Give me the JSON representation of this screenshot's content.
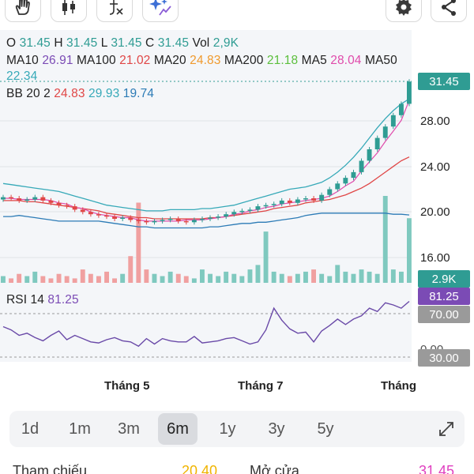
{
  "toolbar": {
    "hand_icon": "hand-icon",
    "candles_icon": "candlestick-icon",
    "indicator_icon": "function-icon",
    "sparkle_icon": "ai-sparkle-icon",
    "settings_icon": "gear-icon",
    "share_icon": "share-icon"
  },
  "ohlc": {
    "o_label": "O",
    "o": "31.45",
    "h_label": "H",
    "h": "31.45",
    "l_label": "L",
    "l": "31.45",
    "c_label": "C",
    "c": "31.45",
    "vol_label": "Vol",
    "vol": "2,9K"
  },
  "ma": {
    "ma10_label": "MA10",
    "ma10": "26.91",
    "ma100_label": "MA100",
    "ma100": "21.02",
    "ma20_label": "MA20",
    "ma20": "24.83",
    "ma200_label": "MA200",
    "ma200": "21.18",
    "ma5_label": "MA5",
    "ma5": "28.04",
    "ma50_label": "MA50",
    "ma50": "22.34"
  },
  "bb": {
    "label": "BB 20 2",
    "mid": "24.83",
    "upper": "29.93",
    "lower": "19.74"
  },
  "rsi": {
    "label": "RSI 14",
    "value": "81.25",
    "level_high": "70.00",
    "level_low": "30.00",
    "hidden_label": "0.00"
  },
  "price_axis": {
    "current": "31.45",
    "ticks": [
      "28.00",
      "24.00",
      "20.00",
      "16.00"
    ],
    "volume": "2.9K"
  },
  "months": [
    "Tháng 5",
    "Tháng 7",
    "Tháng"
  ],
  "ranges": {
    "r1d": "1d",
    "r1m": "1m",
    "r3m": "3m",
    "r6m": "6m",
    "r1y": "1y",
    "r3y": "3y",
    "r5y": "5y",
    "active": "6m"
  },
  "bottom": {
    "ref_label": "Tham chiếu",
    "ref_value": "20.40",
    "open_label": "Mở cửa",
    "open_value": "31.45"
  },
  "colors": {
    "up": "#2f9c93",
    "down": "#e04646",
    "current_tag": "#2f9c93",
    "rsi_tag": "#7b4bb5",
    "level_tag": "#9a9a9a",
    "rsi_line": "#6a4aa8"
  },
  "chart_data": {
    "type": "line",
    "price": {
      "current": 31.45,
      "ylim": [
        14,
        32
      ],
      "closes": [
        21.3,
        21.2,
        21.0,
        21.1,
        21.3,
        21.0,
        20.8,
        20.6,
        20.5,
        20.2,
        20.0,
        19.8,
        19.7,
        19.6,
        19.4,
        19.5,
        19.3,
        19.2,
        19.1,
        19.2,
        19.3,
        19.4,
        19.2,
        19.1,
        19.3,
        19.4,
        19.5,
        19.6,
        19.8,
        20.0,
        20.1,
        20.2,
        20.5,
        20.6,
        20.7,
        21.0,
        20.8,
        21.1,
        21.2,
        21.0,
        21.5,
        22.0,
        22.5,
        23.0,
        23.5,
        24.5,
        25.5,
        26.5,
        27.5,
        28.5,
        29.5,
        31.45
      ],
      "ma5": [
        21.2,
        21.2,
        21.1,
        21.1,
        21.1,
        21.1,
        21.0,
        20.8,
        20.7,
        20.4,
        20.3,
        20.0,
        19.8,
        19.7,
        19.6,
        19.5,
        19.5,
        19.3,
        19.2,
        19.2,
        19.2,
        19.2,
        19.2,
        19.3,
        19.3,
        19.3,
        19.4,
        19.5,
        19.6,
        19.8,
        19.9,
        20.1,
        20.2,
        20.4,
        20.5,
        20.7,
        20.8,
        20.9,
        21.0,
        21.1,
        21.2,
        21.4,
        21.8,
        22.3,
        22.7,
        23.6,
        24.4,
        25.2,
        26.2,
        27.1,
        28.04,
        29.8
      ],
      "ma20": [
        21.0,
        21.0,
        21.0,
        20.9,
        20.9,
        20.8,
        20.7,
        20.6,
        20.5,
        20.4,
        20.3,
        20.2,
        20.1,
        19.9,
        19.8,
        19.7,
        19.6,
        19.5,
        19.5,
        19.4,
        19.4,
        19.4,
        19.4,
        19.4,
        19.4,
        19.4,
        19.5,
        19.5,
        19.6,
        19.7,
        19.8,
        19.9,
        20.0,
        20.1,
        20.3,
        20.4,
        20.5,
        20.6,
        20.8,
        20.9,
        21.0,
        21.1,
        21.3,
        21.5,
        21.8,
        22.1,
        22.5,
        23.0,
        23.5,
        24.0,
        24.5,
        24.83
      ],
      "bb_upper": [
        22.5,
        22.4,
        22.3,
        22.2,
        22.1,
        22.0,
        21.9,
        21.8,
        21.6,
        21.4,
        21.2,
        21.0,
        20.8,
        20.6,
        20.5,
        20.4,
        20.3,
        20.2,
        20.1,
        20.1,
        20.1,
        20.2,
        20.2,
        20.2,
        20.2,
        20.3,
        20.3,
        20.4,
        20.5,
        20.6,
        20.8,
        21.0,
        21.2,
        21.4,
        21.6,
        21.8,
        22.0,
        22.1,
        22.2,
        22.4,
        22.6,
        23.0,
        23.5,
        24.1,
        24.8,
        25.6,
        26.5,
        27.4,
        28.2,
        28.9,
        29.5,
        29.93
      ],
      "bb_lower": [
        19.6,
        19.6,
        19.7,
        19.6,
        19.5,
        19.4,
        19.3,
        19.2,
        19.2,
        19.2,
        19.2,
        19.2,
        19.2,
        19.1,
        19.0,
        18.9,
        18.8,
        18.7,
        18.7,
        18.6,
        18.6,
        18.6,
        18.6,
        18.6,
        18.6,
        18.6,
        18.7,
        18.7,
        18.8,
        18.9,
        19.0,
        19.0,
        19.1,
        19.1,
        19.2,
        19.3,
        19.4,
        19.5,
        19.7,
        19.8,
        19.9,
        19.9,
        19.9,
        19.9,
        19.9,
        19.9,
        19.9,
        19.9,
        19.9,
        19.8,
        19.8,
        19.74
      ]
    },
    "volume": [
      0.3,
      0.2,
      0.4,
      0.3,
      0.5,
      0.3,
      0.2,
      0.4,
      0.3,
      0.2,
      0.6,
      0.4,
      0.3,
      0.5,
      0.2,
      0.4,
      1.2,
      3.6,
      0.6,
      0.4,
      0.3,
      0.5,
      0.4,
      0.3,
      0.2,
      0.6,
      0.4,
      0.3,
      0.5,
      0.4,
      0.3,
      0.6,
      0.8,
      2.3,
      0.5,
      0.4,
      0.3,
      0.4,
      0.5,
      0.6,
      0.4,
      0.3,
      0.8,
      0.5,
      0.4,
      0.6,
      0.5,
      0.4,
      3.9,
      0.6,
      0.5,
      2.9
    ],
    "rsi": {
      "values": [
        58,
        55,
        50,
        52,
        48,
        45,
        50,
        54,
        46,
        50,
        47,
        44,
        43,
        46,
        48,
        45,
        44,
        40,
        47,
        42,
        47,
        45,
        44,
        44,
        49,
        43,
        44,
        45,
        47,
        48,
        45,
        42,
        44,
        55,
        75,
        64,
        56,
        52,
        53,
        44,
        54,
        59,
        65,
        60,
        65,
        68,
        75,
        72,
        80,
        78,
        75,
        81.25
      ],
      "levels": [
        70,
        30
      ],
      "ylim": [
        0,
        100
      ]
    }
  }
}
